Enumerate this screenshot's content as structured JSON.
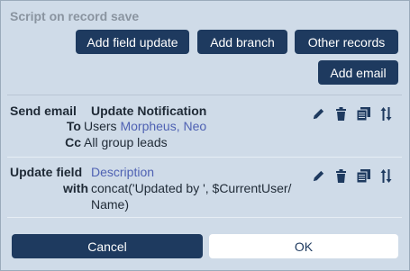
{
  "heading": "Script on record save",
  "toolbar": {
    "add_field_update": "Add field update",
    "add_branch": "Add branch",
    "other_records": "Other records",
    "add_email": "Add email"
  },
  "actions": [
    {
      "type_label": "Send email",
      "title": "Update Notification",
      "to_label": "To",
      "to_prefix": "Users",
      "to_value": "Morpheus, Neo",
      "cc_label": "Cc",
      "cc_value": "All group leads"
    },
    {
      "type_label": "Update field",
      "field": "Description",
      "with_label": "with",
      "with_line1": "concat('Updated by ', $CurrentUser/",
      "with_line2": "Name)"
    }
  ],
  "icons": [
    "pencil-icon",
    "trash-icon",
    "copy-icon",
    "reorder-arrows-icon"
  ],
  "footer": {
    "cancel": "Cancel",
    "ok": "OK"
  },
  "colors": {
    "background": "#cfdbe8",
    "button_dark": "#1e3a5f",
    "link": "#4f62b3"
  }
}
